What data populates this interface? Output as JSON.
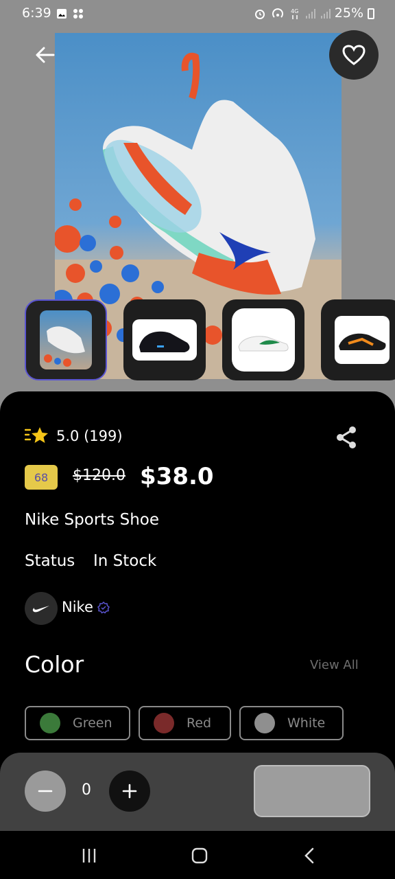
{
  "status_bar": {
    "time": "6:39",
    "battery": "25%"
  },
  "product": {
    "rating": "5.0 (199)",
    "discount_badge": "68",
    "old_price": "$120.0",
    "price": "$38.0",
    "name": "Nike Sports Shoe",
    "status_label": "Status",
    "status_value": "In Stock",
    "brand": "Nike"
  },
  "colors_section": {
    "heading": "Color",
    "view_all": "View All",
    "options": [
      {
        "label": "Green",
        "swatch": "#3b7a3a"
      },
      {
        "label": "Red",
        "swatch": "#7a2a2a"
      },
      {
        "label": "White",
        "swatch": "#8f8f8f"
      }
    ]
  },
  "cart": {
    "quantity": "0"
  },
  "theme": {
    "accent": "#5a54d1",
    "badge": "#e5c94a",
    "star": "#f5c518"
  }
}
